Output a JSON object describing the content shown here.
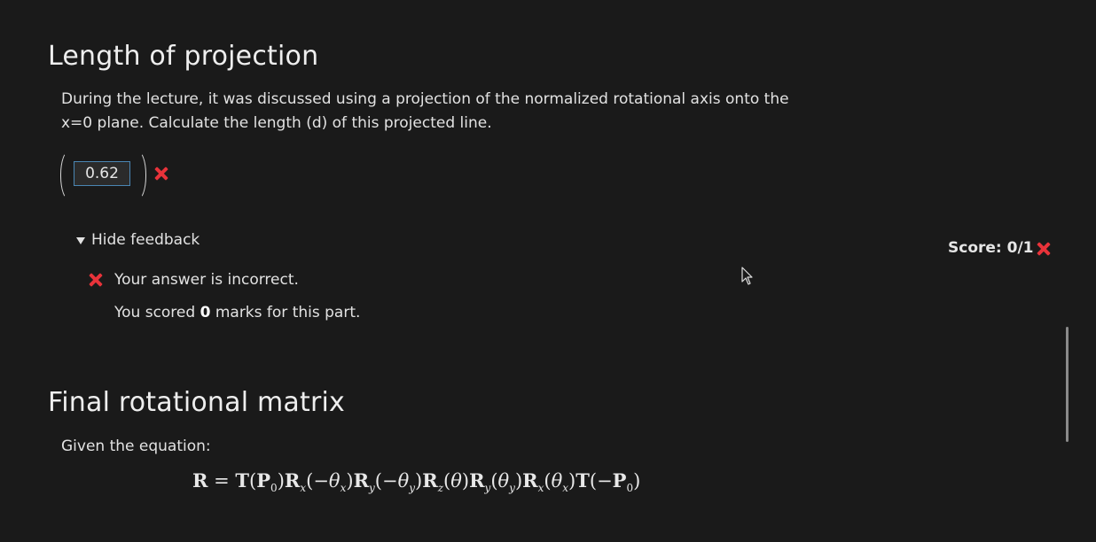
{
  "section1": {
    "title": "Length of projection",
    "prompt": "During the lecture, it was discussed using a projection of the normalized rotational axis onto the x=0 plane. Calculate the length (d) of this projected line.",
    "answer_value": "0.62",
    "feedback_toggle_label": "Hide feedback",
    "score_label": "Score: 0/1",
    "feedback_message": "Your answer is incorrect.",
    "marks_prefix": "You scored ",
    "marks_value": "0",
    "marks_suffix": " marks for this part."
  },
  "section2": {
    "title": "Final rotational matrix",
    "prompt": "Given the equation:",
    "equation": "R = T(P0)Rx(−θx)Ry(−θy)Rz(θ)Ry(θy)Rx(θx)T(−P0)"
  },
  "colors": {
    "background": "#1a1a1a",
    "incorrect": "#e8333a",
    "input_border": "#4a86b3"
  },
  "icons": [
    "cross-icon",
    "triangle-down-icon",
    "mouse-cursor-icon"
  ]
}
